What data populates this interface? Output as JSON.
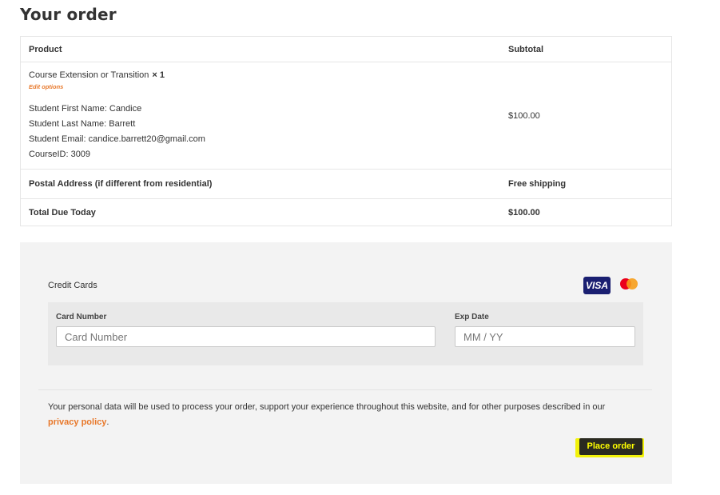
{
  "page": {
    "title": "Your order"
  },
  "order_table": {
    "headers": {
      "product": "Product",
      "subtotal": "Subtotal"
    },
    "item": {
      "name": "Course Extension or Transition",
      "quantity": "× 1",
      "edit_label": "Edit options",
      "meta": [
        "Student First Name: Candice",
        "Student Last Name: Barrett",
        "Student Email: candice.barrett20@gmail.com",
        "CourseID: 3009"
      ],
      "subtotal": "$100.00"
    },
    "shipping": {
      "label": "Postal Address (if different from residential)",
      "value": "Free shipping"
    },
    "total": {
      "label": "Total Due Today",
      "value": "$100.00"
    }
  },
  "payment": {
    "method_label": "Credit Cards",
    "visa_text": "VISA",
    "card_number": {
      "label": "Card Number",
      "placeholder": "Card Number",
      "value": ""
    },
    "exp_date": {
      "label": "Exp Date",
      "placeholder": "MM / YY",
      "value": ""
    },
    "privacy_text": "Your personal data will be used to process your order, support your experience throughout this website, and for other purposes described in our",
    "privacy_link": "privacy policy",
    "privacy_end": ".",
    "place_order_label": "Place order"
  },
  "colors": {
    "accent_orange": "#e8782a",
    "button_bg": "#2a2a20",
    "button_text": "#ffff00",
    "highlight": "#f2f20a",
    "visa_blue": "#1a1f71"
  },
  "icons": {
    "visa": "visa-logo-icon",
    "mastercard": "mastercard-logo-icon"
  }
}
